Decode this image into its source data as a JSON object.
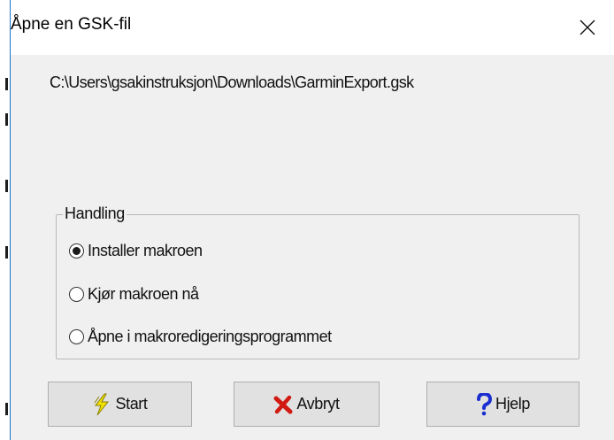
{
  "window": {
    "title": "Åpne en GSK-fil"
  },
  "file_path": "C:\\Users\\gsakinstruksjon\\Downloads\\GarminExport.gsk",
  "action_group": {
    "legend": "Handling",
    "options": [
      {
        "label": "Installer makroen",
        "selected": true
      },
      {
        "label": "Kjør makroen nå",
        "selected": false
      },
      {
        "label": "Åpne i makroredigeringsprogrammet",
        "selected": false
      }
    ]
  },
  "buttons": {
    "start": {
      "label": "Start",
      "icon": "lightning-icon"
    },
    "cancel": {
      "label": "Avbryt",
      "icon": "red-x-icon"
    },
    "help": {
      "label": "Hjelp",
      "icon": "question-mark-icon"
    }
  },
  "colors": {
    "dialog_bg": "#f0f0f0",
    "titlebar_bg": "#ffffff",
    "button_bg": "#e1e1e1",
    "window_border": "#1a73c9"
  }
}
